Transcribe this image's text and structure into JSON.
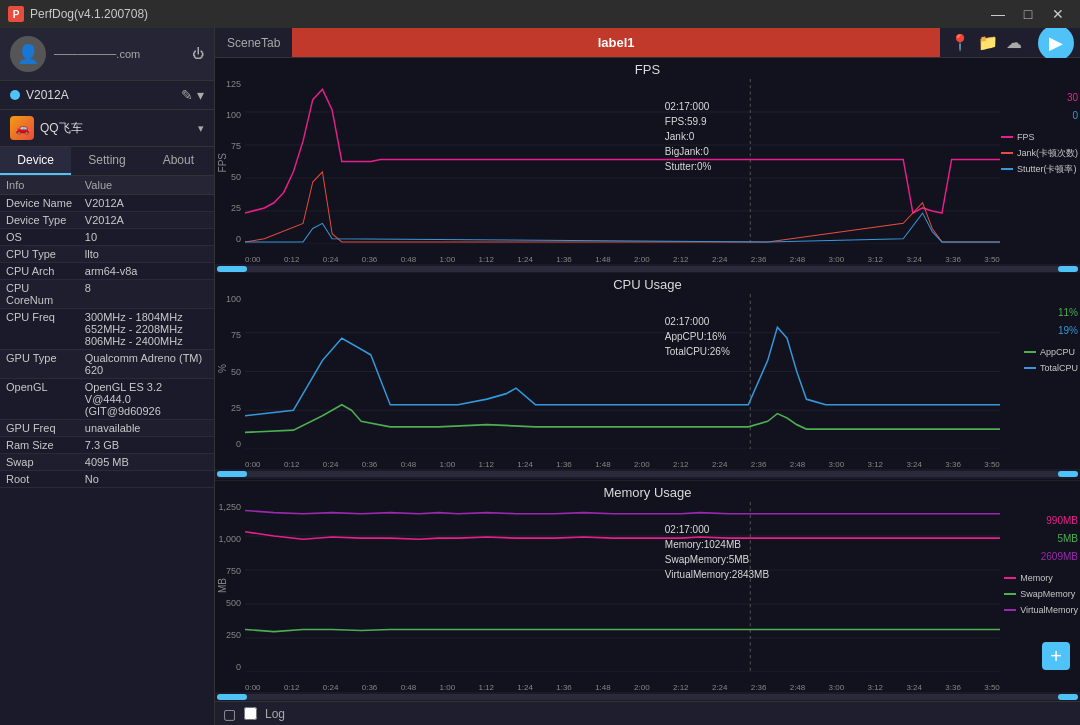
{
  "titlebar": {
    "title": "PerfDog(v4.1.200708)",
    "controls": {
      "minimize": "—",
      "maximize": "□",
      "close": "✕"
    }
  },
  "profile": {
    "name": "────────.com",
    "power_icon": "⏻"
  },
  "device": {
    "indicator_color": "#4fc3f7",
    "name": "V2012A",
    "edit_icon": "✎",
    "dropdown_icon": "▾"
  },
  "app": {
    "name": "QQ飞车",
    "dropdown_icon": "▾"
  },
  "tabs": [
    {
      "id": "device",
      "label": "Device",
      "active": true
    },
    {
      "id": "setting",
      "label": "Setting",
      "active": false
    },
    {
      "id": "about",
      "label": "About",
      "active": false
    }
  ],
  "device_info": {
    "headers": {
      "info": "Info",
      "value": "Value"
    },
    "rows": [
      {
        "info": "Device Name",
        "value": "V2012A"
      },
      {
        "info": "Device Type",
        "value": "V2012A"
      },
      {
        "info": "OS",
        "value": "10"
      },
      {
        "info": "CPU Type",
        "value": "llto"
      },
      {
        "info": "CPU Arch",
        "value": "arm64-v8a"
      },
      {
        "info": "CPU CoreNum",
        "value": "8"
      },
      {
        "info": "CPU Freq",
        "value": "300MHz - 1804MHz\n652MHz - 2208MHz\n806MHz - 2400MHz"
      },
      {
        "info": "GPU Type",
        "value": "Qualcomm Adreno (TM) 620"
      },
      {
        "info": "OpenGL",
        "value": "OpenGL ES 3.2\nV@444.0\n(GIT@9d60926"
      },
      {
        "info": "GPU Freq",
        "value": "unavailable"
      },
      {
        "info": "Ram Size",
        "value": "7.3 GB"
      },
      {
        "info": "Swap",
        "value": "4095 MB"
      },
      {
        "info": "Root",
        "value": "No"
      }
    ]
  },
  "scene_tab": {
    "label": "SceneTab"
  },
  "label1": {
    "label": "label1"
  },
  "charts": {
    "fps": {
      "title": "FPS",
      "y_label": "FPS",
      "tooltip": {
        "time": "02:17:000",
        "fps": "FPS:59.9",
        "jank": "Jank:0",
        "bigjank": "BigJank:0",
        "stutter": "Stutter:0%"
      },
      "legend": [
        {
          "label": "FPS",
          "color": "#e91e8c"
        },
        {
          "label": "Jank(卡顿次数)",
          "color": "#e74c3c"
        },
        {
          "label": "Stutter(卡顿率)",
          "color": "#3498db"
        }
      ],
      "values_right": [
        "30",
        "0"
      ],
      "y_ticks": [
        "125",
        "100",
        "75",
        "50",
        "25",
        "0"
      ],
      "x_ticks": [
        "0:00",
        "0:12",
        "0:24",
        "0:36",
        "0:48",
        "1:00",
        "1:12",
        "1:24",
        "1:36",
        "1:48",
        "2:00",
        "2:12",
        "2:24",
        "2:36",
        "2:48",
        "3:00",
        "3:12",
        "3:24",
        "3:36",
        "3:50"
      ]
    },
    "cpu": {
      "title": "CPU Usage",
      "y_label": "%",
      "tooltip": {
        "time": "02:17:000",
        "appcpu": "AppCPU:16%",
        "totalcpu": "TotalCPU:26%"
      },
      "legend": [
        {
          "label": "AppCPU",
          "color": "#4caf50"
        },
        {
          "label": "TotalCPU",
          "color": "#3498db"
        }
      ],
      "values_right": [
        "11%",
        "19%"
      ],
      "y_ticks": [
        "100",
        "75",
        "50",
        "25",
        "0"
      ]
    },
    "memory": {
      "title": "Memory Usage",
      "y_label": "MB",
      "tooltip": {
        "time": "02:17:000",
        "memory": "Memory:1024MB",
        "swap": "SwapMemory:5MB",
        "virtual": "VirtualMemory:2843MB"
      },
      "legend": [
        {
          "label": "Memory",
          "color": "#e91e8c"
        },
        {
          "label": "SwapMemory",
          "color": "#4caf50"
        },
        {
          "label": "VirtualMemory",
          "color": "#9c27b0"
        }
      ],
      "values_right": [
        "990MB",
        "5MB",
        "2609MB"
      ],
      "y_ticks": [
        "1,250",
        "1,000",
        "750",
        "500",
        "250",
        "0"
      ]
    }
  },
  "bottom": {
    "log_label": "Log",
    "plus_icon": "+"
  },
  "icons": {
    "location": "📍",
    "folder": "📁",
    "cloud": "☁",
    "play": "▶",
    "power": "⏻",
    "edit": "✏",
    "dropdown": "▾"
  }
}
